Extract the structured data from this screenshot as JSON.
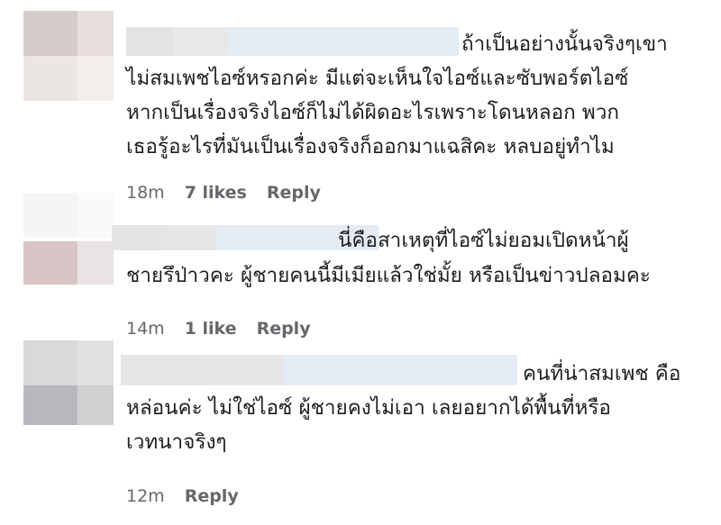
{
  "comments": [
    {
      "lines": [
        "ถ้าเป็นอย่างนั้นจริงๆเขา",
        "ไม่สมเพชไอซ์หรอกค่ะ มีแต่จะเห็นใจไอซ์และซับพอร์ตไอซ์",
        "หากเป็นเรื่องจริงไอซ์ก็ไม่ได้ผิดอะไรเพราะโดนหลอก พวก",
        "เธอรู้อะไรที่มันเป็นเรื่องจริงก็ออกมาแฉสิคะ หลบอยู่ทำไม"
      ],
      "time": "18m",
      "likes": "7 likes",
      "reply": "Reply"
    },
    {
      "lines": [
        "นี่คือสาเหตุที่ไอซ์ไม่ยอมเปิดหน้าผู้",
        "ชายรึป่าวคะ ผู้ชายคนนี้มีเมียแล้วใช่มั้ย หรือเป็นข่าวปลอมคะ"
      ],
      "time": "14m",
      "likes": "1 like",
      "reply": "Reply"
    },
    {
      "lines": [
        "คนที่น่าสมเพช คือ",
        "หล่อนค่ะ ไม่ใช่ไอซ์ ผู้ชายคงไม่เอา เลยอยากได้พื้นที่หรือ",
        "เวทนาจริงๆ"
      ],
      "time": "12m",
      "likes": "",
      "reply": "Reply"
    }
  ],
  "colors": {
    "text": "#1c1e21",
    "meta": "#65676b",
    "blur_gray": "#e4e4e4",
    "blur_blue": "#e3ecf7"
  }
}
